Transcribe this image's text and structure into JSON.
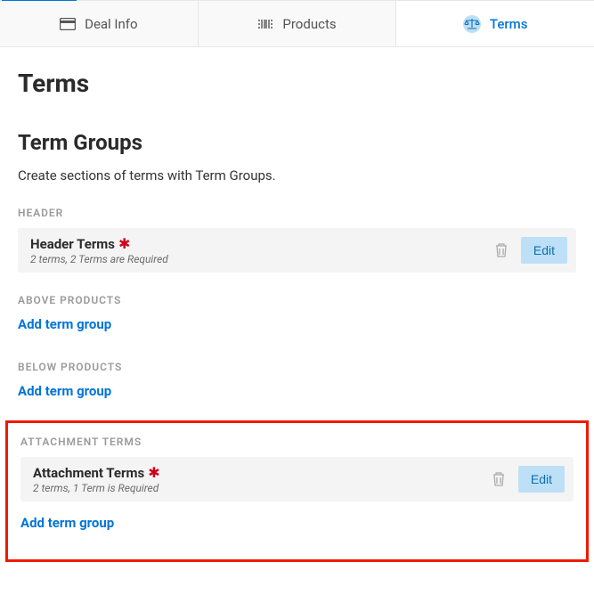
{
  "tabs": {
    "deal_info": "Deal Info",
    "products": "Products",
    "terms": "Terms"
  },
  "page_title": "Terms",
  "term_groups": {
    "title": "Term Groups",
    "description": "Create sections of terms with Term Groups.",
    "add_label": "Add term group",
    "edit_label": "Edit",
    "sections": {
      "header": {
        "label": "HEADER"
      },
      "above_products": {
        "label": "ABOVE PRODUCTS"
      },
      "below_products": {
        "label": "BELOW PRODUCTS"
      },
      "attachment_terms": {
        "label": "ATTACHMENT TERMS"
      }
    },
    "cards": {
      "header_terms": {
        "title": "Header Terms",
        "subtitle": "2 terms, 2 Terms are Required"
      },
      "attachment_terms": {
        "title": "Attachment Terms",
        "subtitle": "2 terms, 1 Term is Required"
      }
    }
  }
}
